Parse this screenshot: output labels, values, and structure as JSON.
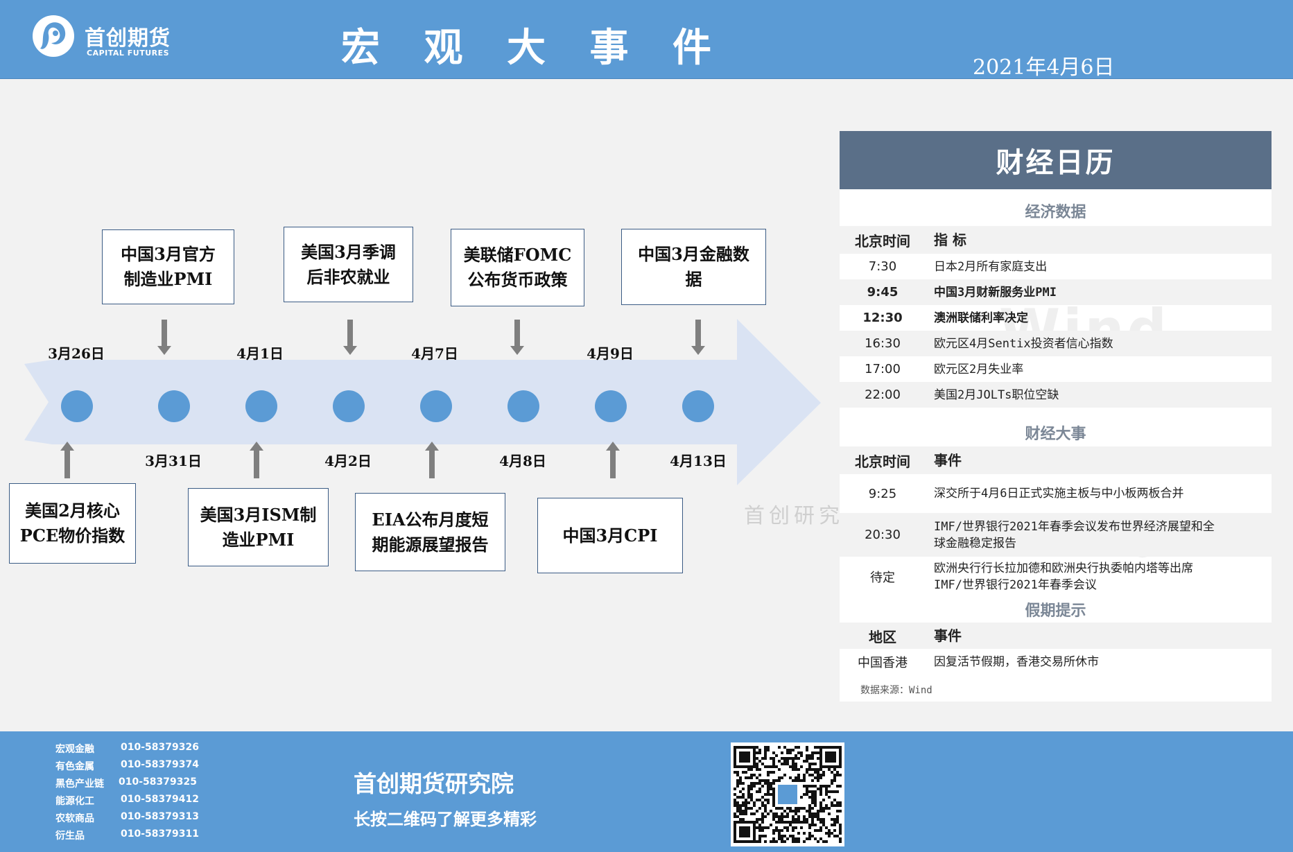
{
  "header": {
    "brand_cn": "首创期货",
    "brand_en": "CAPITAL FUTURES",
    "title": "宏 观 大 事 件",
    "date": "2021年4月6日"
  },
  "timeline": {
    "dates_top": [
      "3月26日",
      "4月1日",
      "4月7日",
      "4月9日"
    ],
    "dates_bottom": [
      "3月31日",
      "4月2日",
      "4月8日",
      "4月13日"
    ],
    "events_top": [
      "中国3月官方\n制造业PMI",
      "美国3月季调\n后非农就业",
      "美联储FOMC\n公布货币政策",
      "中国3月金融数\n据"
    ],
    "events_bottom": [
      "美国2月核心\nPCE物价指数",
      "美国3月ISM制\n造业PMI",
      "EIA公布月度短\n期能源展望报告",
      "中国3月CPI"
    ],
    "colors": {
      "arrow": "#dae3f3",
      "node": "#5b9bd5",
      "pointer": "#7f7f7f"
    }
  },
  "calendar": {
    "title": "财经日历",
    "econ_section": "经济数据",
    "econ_header": [
      "北京时间",
      "指 标"
    ],
    "econ_rows": [
      {
        "time": "7:30",
        "item": "日本2月所有家庭支出",
        "bold": false
      },
      {
        "time": "9:45",
        "item": "中国3月财新服务业PMI",
        "bold": true
      },
      {
        "time": "12:30",
        "item": "澳洲联储利率决定",
        "bold": true
      },
      {
        "time": "16:30",
        "item": "欧元区4月Sentix投资者信心指数",
        "bold": false
      },
      {
        "time": "17:00",
        "item": "欧元区2月失业率",
        "bold": false
      },
      {
        "time": "22:00",
        "item": "美国2月JOLTs职位空缺",
        "bold": false
      }
    ],
    "events_section": "财经大事",
    "events_header": [
      "北京时间",
      "事件"
    ],
    "events_rows": [
      {
        "time": "9:25",
        "item": "深交所于4月6日正式实施主板与中小板两板合并"
      },
      {
        "time": "20:30",
        "item": "IMF/世界银行2021年春季会议发布世界经济展望和全\n球金融稳定报告"
      },
      {
        "time": "待定",
        "item": "欧洲央行行长拉加德和欧洲央行执委帕内塔等出席\nIMF/世界银行2021年春季会议"
      }
    ],
    "holiday_section": "假期提示",
    "holiday_header": [
      "地区",
      "事件"
    ],
    "holiday_rows": [
      {
        "region": "中国香港",
        "item": "因复活节假期，香港交易所休市"
      }
    ],
    "source": "数据来源：Wind",
    "watermark": "Wind",
    "watermark2": "首创研究"
  },
  "footer": {
    "contacts": [
      {
        "dept": "宏观金融",
        "phone": "010-58379326"
      },
      {
        "dept": "有色金属",
        "phone": "010-58379374"
      },
      {
        "dept": "黑色产业链",
        "phone": "010-58379325"
      },
      {
        "dept": "能源化工",
        "phone": "010-58379412"
      },
      {
        "dept": "农软商品",
        "phone": "010-58379313"
      },
      {
        "dept": "衍生品",
        "phone": "010-58379311"
      }
    ],
    "org": "首创期货研究院",
    "slogan": "长按二维码了解更多精彩"
  }
}
